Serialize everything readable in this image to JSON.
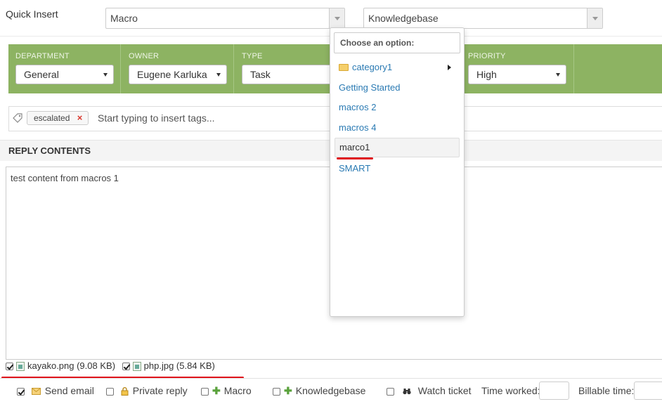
{
  "quick_insert": {
    "label": "Quick Insert",
    "macro_select": "Macro",
    "kb_select": "Knowledgebase"
  },
  "properties": [
    {
      "label": "DEPARTMENT",
      "value": "General"
    },
    {
      "label": "OWNER",
      "value": "Eugene Karluka"
    },
    {
      "label": "TYPE",
      "value": "Task"
    },
    {
      "label": "PRIORITY",
      "value": "High"
    }
  ],
  "tags": {
    "items": [
      "escalated"
    ],
    "remove_glyph": "×",
    "placeholder": "Start typing to insert tags..."
  },
  "reply": {
    "title": "REPLY CONTENTS",
    "content": "test content from macros 1"
  },
  "attachments": [
    {
      "name": "kayako.png (9.08 KB)",
      "checked": true
    },
    {
      "name": "php.jpg (5.84 KB)",
      "checked": true
    }
  ],
  "options": {
    "send_email": "Send email",
    "private_reply": "Private reply",
    "macro": "Macro",
    "knowledgebase": "Knowledgebase",
    "watch_ticket": "Watch ticket",
    "time_worked": "Time worked:",
    "billable_time": "Billable time:"
  },
  "macro_dropdown": {
    "search_placeholder": "Choose an option:",
    "items": [
      "category1",
      "Getting Started",
      "macros 2",
      "macros 4",
      "marco1",
      "SMART"
    ],
    "highlighted": "marco1"
  },
  "colors": {
    "properties_bar": "#8db362",
    "link": "#2a7ab3",
    "annotation_red": "#e0141c"
  }
}
